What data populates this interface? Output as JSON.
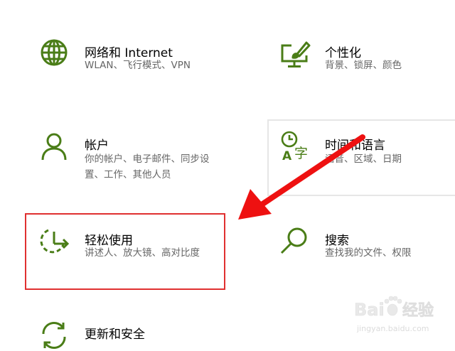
{
  "tiles": {
    "network": {
      "title": "网络和 Internet",
      "desc": "WLAN、飞行模式、VPN",
      "icon": "globe-icon"
    },
    "personalization": {
      "title": "个性化",
      "desc": "背景、锁屏、颜色",
      "icon": "paint-monitor-icon"
    },
    "accounts": {
      "title": "帐户",
      "desc_line1": "你的帐户、电子邮件、同步设",
      "desc_line2": "置、工作、其他人员",
      "icon": "person-icon"
    },
    "time_language": {
      "title": "时间和语言",
      "desc": "语音、区域、日期",
      "icon": "clock-language-icon"
    },
    "ease_of_access": {
      "title": "轻松使用",
      "desc": "讲述人、放大镜、高对比度",
      "icon": "ease-of-access-icon"
    },
    "search": {
      "title": "搜索",
      "desc": "查找我的文件、权限",
      "icon": "search-icon"
    },
    "update_security": {
      "title": "更新和安全",
      "icon": "update-icon"
    }
  },
  "watermark": {
    "brand": "Bai",
    "brand2": "经验",
    "url": "jingyan.baidu.com"
  },
  "colors": {
    "accent": "#4a7d17",
    "highlight": "#e03030",
    "text": "#000000",
    "subtext": "#666666"
  }
}
